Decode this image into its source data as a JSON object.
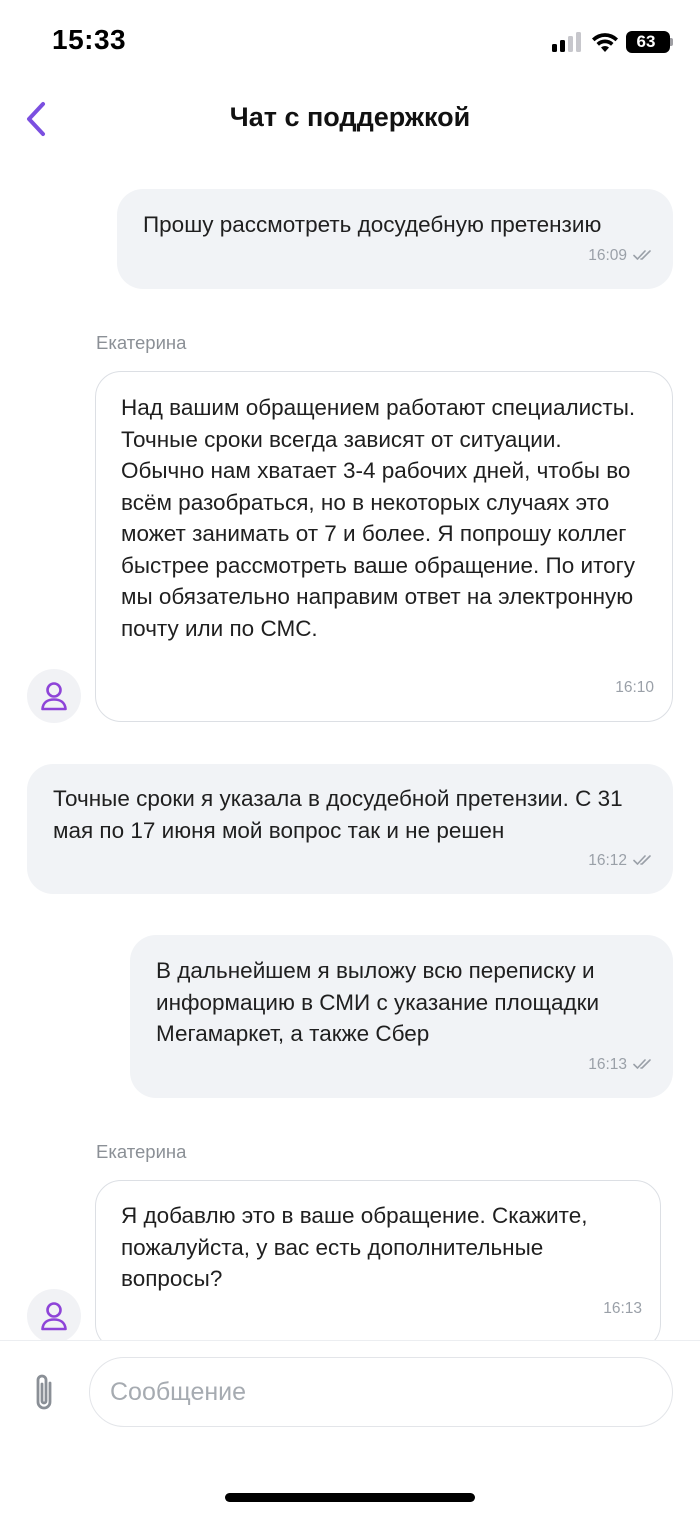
{
  "status_bar": {
    "time": "15:33",
    "battery": "63"
  },
  "header": {
    "title": "Чат с поддержкой",
    "back_icon": "chevron-left-icon"
  },
  "messages": [
    {
      "direction": "outgoing",
      "text": "Прошу рассмотреть досудебную претензию",
      "time": "16:09",
      "read": true
    },
    {
      "direction": "incoming",
      "sender": "Екатерина",
      "text": "Над вашим обращением работают специалисты. Точные сроки всегда зависят от ситуации. Обычно нам хватает 3-4 рабочих дней, чтобы во всём разобраться, но в некоторых случаях это может занимать от 7 и более. Я попрошу коллег быстрее рассмотреть ваше обращение. По итогу мы обязательно направим ответ на электронную почту или по СМС.",
      "time": "16:10"
    },
    {
      "direction": "outgoing",
      "text": "Точные сроки я указала в досудебной претензии. С 31 мая по 17 июня мой вопрос так и не решен",
      "time": "16:12",
      "read": true
    },
    {
      "direction": "outgoing",
      "text": "В дальнейшем я выложу всю переписку и информацию в СМИ с указание площадки Мегамаркет, а также Сбер",
      "time": "16:13",
      "read": true
    },
    {
      "direction": "incoming",
      "sender": "Екатерина",
      "text": "Я добавлю это в ваше обращение. Скажите, пожалуйста, у вас есть дополнительные вопросы?",
      "time": "16:13"
    }
  ],
  "composer": {
    "placeholder": "Сообщение",
    "attach_icon": "paperclip-icon"
  },
  "colors": {
    "accent": "#7b4fe0",
    "outgoing_bubble": "#f1f3f6",
    "incoming_border": "#dcdfe4",
    "meta": "#9aa0a8"
  }
}
